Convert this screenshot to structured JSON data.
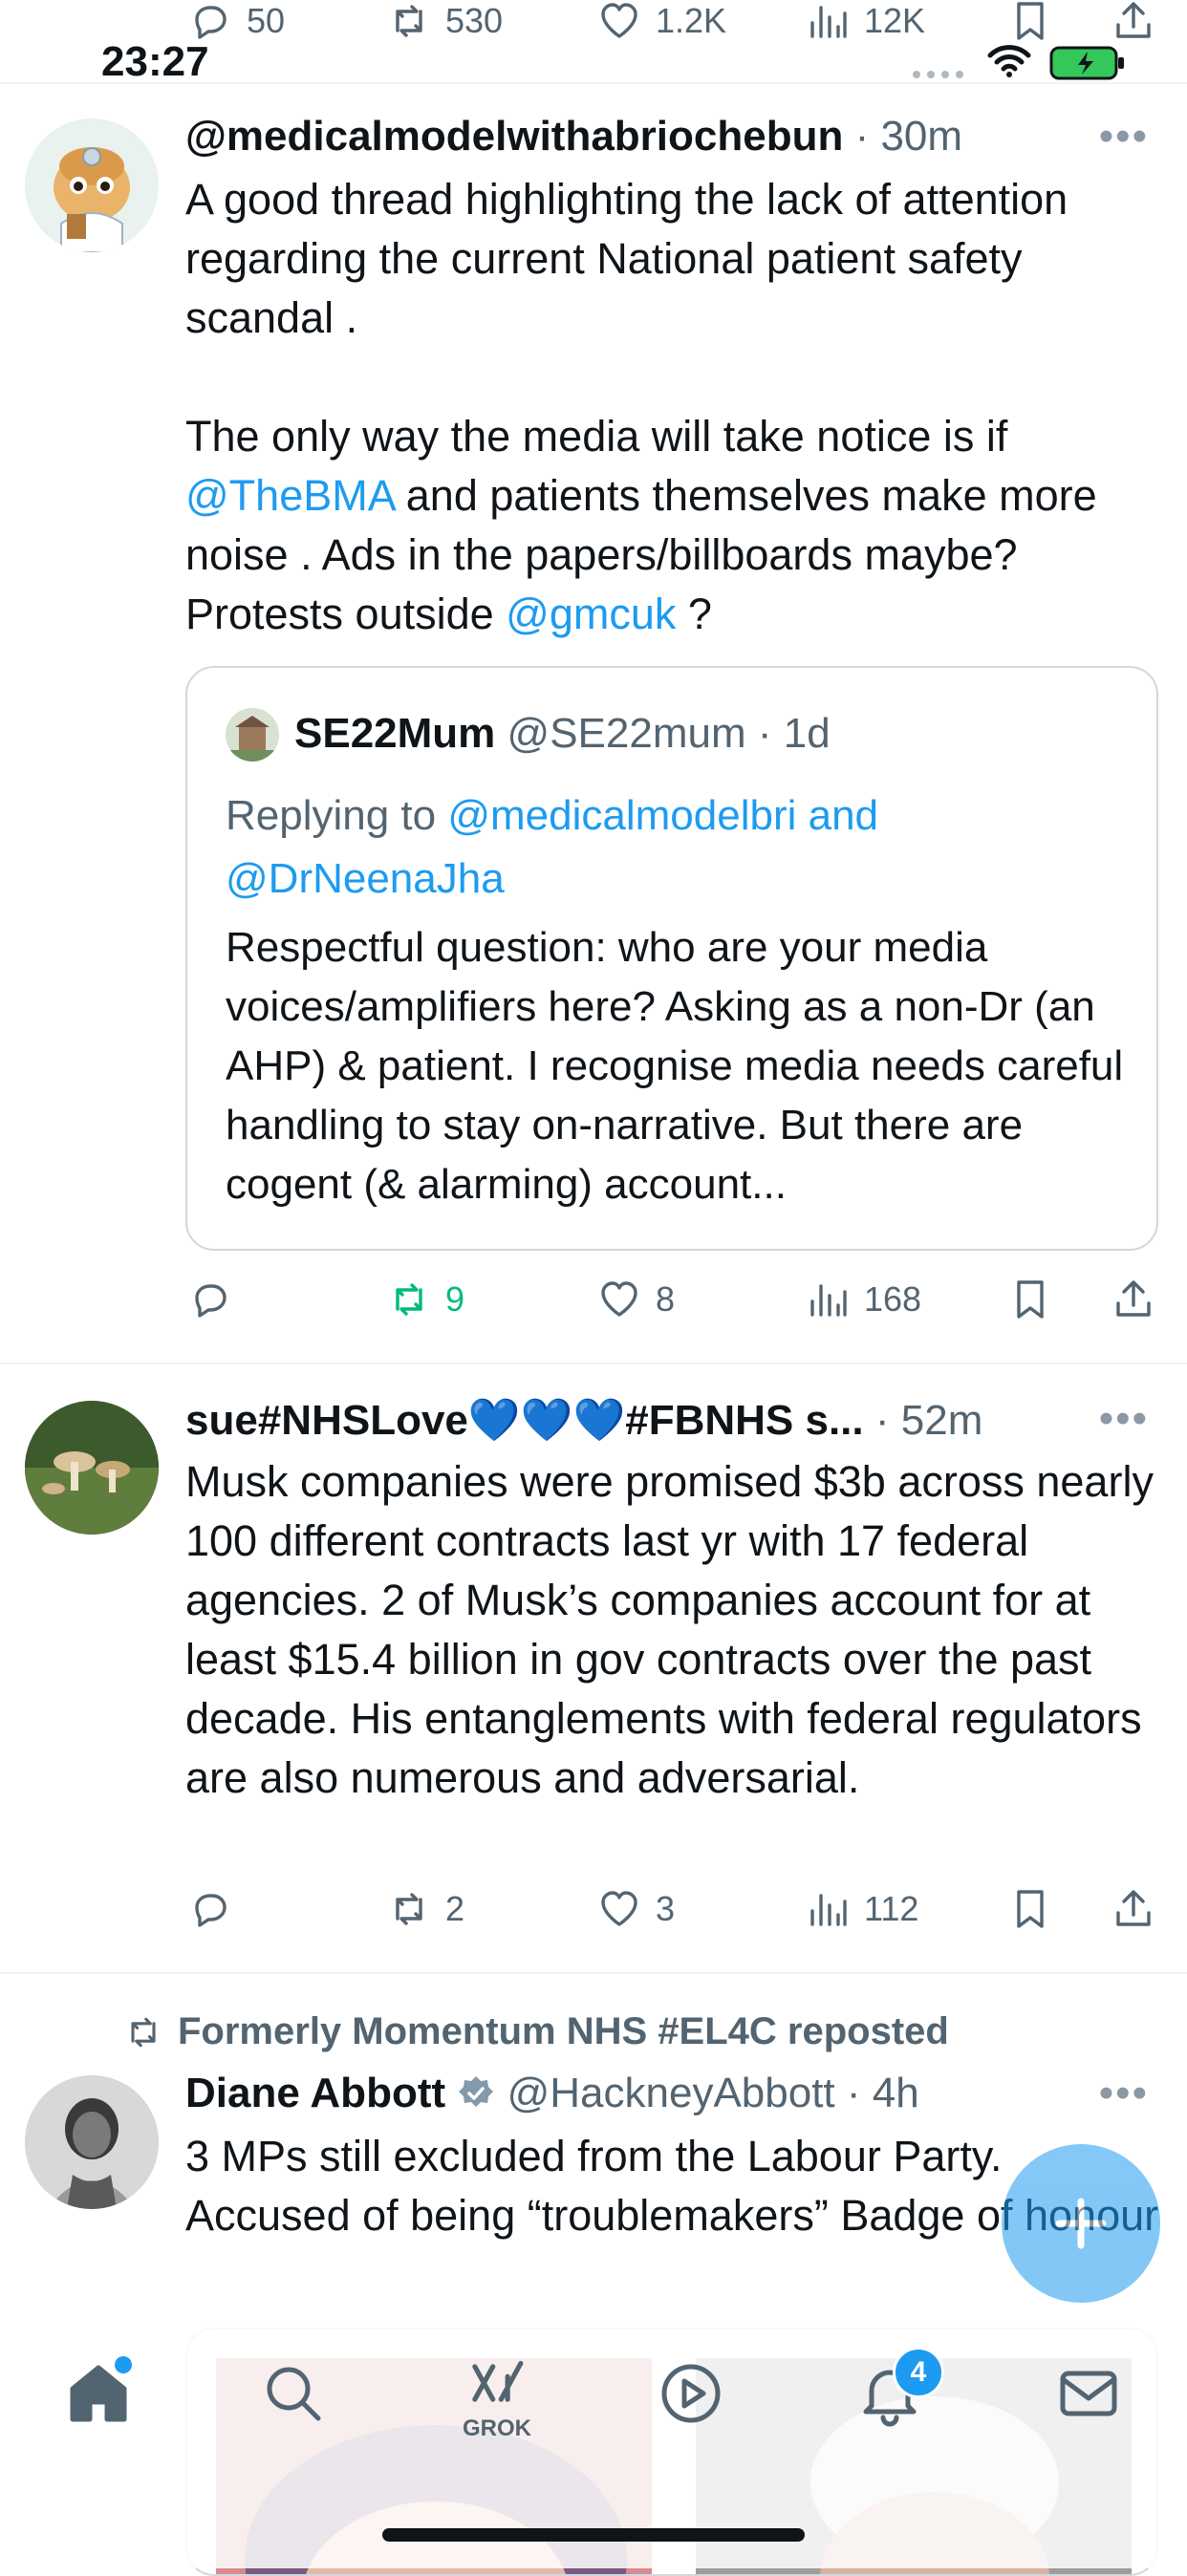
{
  "status_bar": {
    "time": "23:27"
  },
  "top_action_bar": {
    "replies": "50",
    "reposts": "530",
    "likes": "1.2K",
    "views": "12K"
  },
  "tweets": [
    {
      "display_name": "@medicalmodelwithabriochebun",
      "time": "30m",
      "body_p1": "A good thread highlighting the lack of attention regarding the current National patient safety scandal .",
      "body_p2_a": "The only way the media will take notice is if ",
      "mention1": "@TheBMA",
      "body_p2_b": " and patients themselves make more noise . Ads in the papers/billboards maybe? Protests outside ",
      "mention2": "@gmcuk",
      "body_p2_c": " ?",
      "quote": {
        "display_name": "SE22Mum",
        "handle": "@SE22mum",
        "time": "1d",
        "replying_to_prefix": "Replying to ",
        "replying_to_a": "@medicalmodelbri",
        "replying_to_and": " and",
        "replying_to_b": "@DrNeenaJha",
        "text": "Respectful question: who are your media voices/amplifiers here? Asking as a non-Dr (an AHP) & patient. I recognise media needs careful handling to stay on-narrative. But there are cogent (& alarming) account..."
      },
      "actions": {
        "replies": "",
        "reposts": "9",
        "likes": "8",
        "views": "168"
      }
    },
    {
      "display_name": "sue#NHSLove💙💙💙#FBNHS s...",
      "time": "52m",
      "body": "Musk companies were promised $3b across nearly 100 different contracts last yr with 17 federal agencies. 2 of Musk’s companies account for at least $15.4 billion in gov contracts over the past decade. His entanglements with federal regulators are also numerous and adversarial.",
      "actions": {
        "replies": "",
        "reposts": "2",
        "likes": "3",
        "views": "112"
      }
    },
    {
      "repost_label": "Formerly Momentum NHS #EL4C reposted",
      "display_name": "Diane Abbott",
      "handle": "@HackneyAbbott",
      "time": "4h",
      "body": "3 MPs still excluded from the Labour Party. Accused of being “troublemakers” Badge of honour"
    }
  ],
  "nav": {
    "grok_label": "GROK",
    "notifications_badge": "4"
  },
  "colors": {
    "accent": "#1d9bf0",
    "repost_green": "#00ba7c",
    "text": "#0f1419",
    "secondary": "#536471"
  }
}
